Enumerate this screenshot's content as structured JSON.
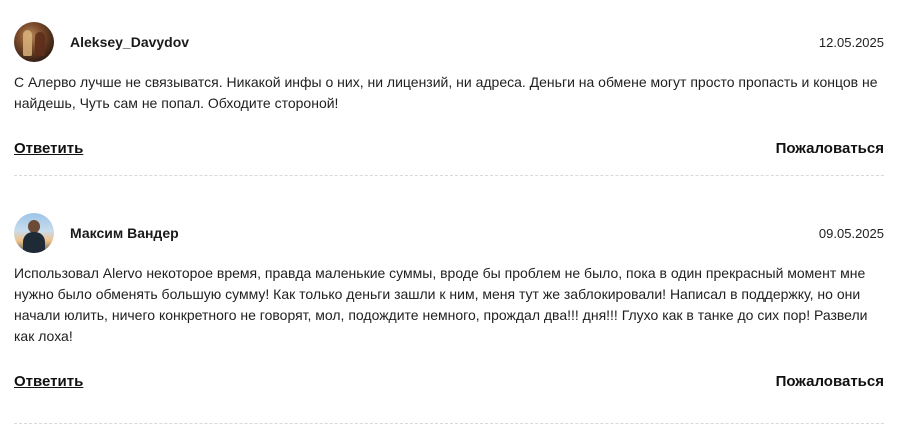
{
  "comments": [
    {
      "author": "Aleksey_Davydov",
      "date": "12.05.2025",
      "text": "С Алерво лучше не связыватся. Никакой инфы о них, ни лицензий, ни адреса. Деньги на обмене могут просто пропасть и концов не найдешь, Чуть сам не попал. Обходите стороной!",
      "reply_label": "Ответить",
      "report_label": "Пожаловаться"
    },
    {
      "author": "Максим Вандер",
      "date": "09.05.2025",
      "text": "Использовал Alervo некоторое время, правда маленькие суммы, вроде бы проблем не было, пока в один прекрасный момент мне нужно было обменять большую сумму! Как только деньги зашли к ним, меня тут же заблокировали! Написал в поддержку, но они начали юлить, ничего конкретного не говорят, мол, подождите немного, прождал два!!! дня!!! Глухо как в танке до сих пор! Развели как лоха!",
      "reply_label": "Ответить",
      "report_label": "Пожаловаться"
    }
  ]
}
